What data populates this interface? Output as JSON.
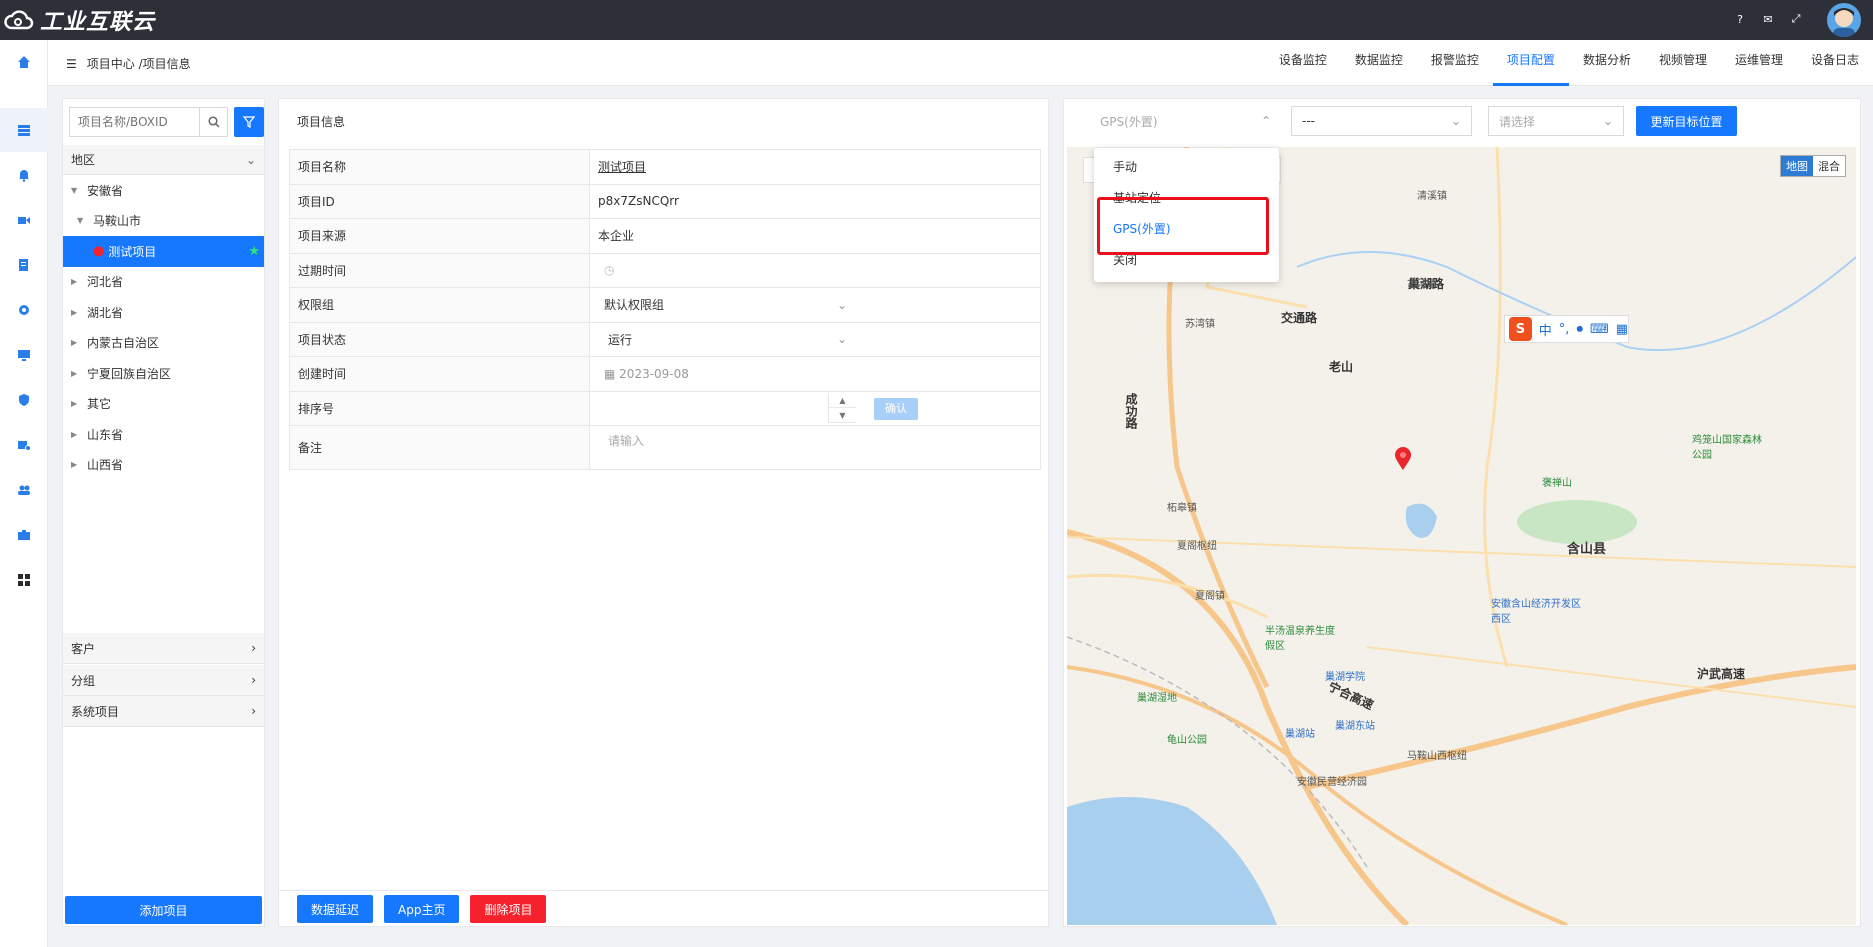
{
  "app": {
    "logo_text": "工业互联云"
  },
  "header": {
    "breadcrumb": "项目中心 /项目信息",
    "tabs": [
      {
        "label": "设备监控",
        "active": false
      },
      {
        "label": "数据监控",
        "active": false
      },
      {
        "label": "报警监控",
        "active": false
      },
      {
        "label": "项目配置",
        "active": true
      },
      {
        "label": "数据分析",
        "active": false
      },
      {
        "label": "视频管理",
        "active": false
      },
      {
        "label": "运维管理",
        "active": false
      },
      {
        "label": "设备日志",
        "active": false
      }
    ]
  },
  "sidebar": {
    "search_placeholder": "项目名称/BOXID",
    "region_label": "地区",
    "tree": [
      {
        "label": "安徽省",
        "level": 0,
        "expanded": true
      },
      {
        "label": "马鞍山市",
        "level": 1,
        "expanded": true
      },
      {
        "label": "测试项目",
        "level": 2,
        "selected": true
      },
      {
        "label": "河北省",
        "level": 0
      },
      {
        "label": "湖北省",
        "level": 0
      },
      {
        "label": "内蒙古自治区",
        "level": 0
      },
      {
        "label": "宁夏回族自治区",
        "level": 0
      },
      {
        "label": "其它",
        "level": 0
      },
      {
        "label": "山东省",
        "level": 0
      },
      {
        "label": "山西省",
        "level": 0
      }
    ],
    "accordions": [
      "客户",
      "分组",
      "系统项目"
    ],
    "add_button": "添加项目"
  },
  "project": {
    "panel_title": "项目信息",
    "rows": {
      "name_label": "项目名称",
      "name_value": "测试项目",
      "id_label": "项目ID",
      "id_value": "p8x7ZsNCQrr",
      "source_label": "项目来源",
      "source_value": "本企业",
      "expire_label": "过期时间",
      "perm_label": "权限组",
      "perm_value": "默认权限组",
      "status_label": "项目状态",
      "status_value": "运行",
      "created_label": "创建时间",
      "created_value": "2023-09-08",
      "sort_label": "排序号",
      "sort_confirm": "确认",
      "remark_label": "备注",
      "remark_placeholder": "请输入"
    },
    "buttons": {
      "data_delay": "数据延迟",
      "app_home": "App主页",
      "delete": "删除项目"
    }
  },
  "map": {
    "location_select": "GPS(外置)",
    "second_select": "---",
    "third_select_placeholder": "请选择",
    "update_button": "更新目标位置",
    "dropdown_options": [
      {
        "label": "手动",
        "selected": false
      },
      {
        "label": "基站定位",
        "selected": false
      },
      {
        "label": "GPS(外置)",
        "selected": true
      },
      {
        "label": "关闭",
        "selected": false
      }
    ],
    "toggle": {
      "map": "地图",
      "hybrid": "混合"
    },
    "ime_label": "中",
    "labels": {
      "l1": "巢湖路",
      "l2": "交通路",
      "l3": "老山",
      "l4": "成功路",
      "l5": "含山县",
      "l6": "褒禅山",
      "l7": "鸡笼山国家森林公园",
      "l8": "夏阁枢纽",
      "l9": "巢湖学院",
      "l10": "巢湖站",
      "l11": "巢湖东站",
      "l12": "沪武高速",
      "l13": "宁合高速",
      "l14": "马鞍山西枢纽",
      "l15": "安徽含山经济开发区西区",
      "l16": "半汤温泉养生度假区",
      "l17": "巢湖湿地",
      "l18": "龟山公园",
      "l19": "安徽民营经济园",
      "l20": "苏湾镇",
      "l21": "古河镇",
      "l22": "清溪镇",
      "l23": "夏阁镇",
      "l24": "柘皋镇"
    }
  }
}
